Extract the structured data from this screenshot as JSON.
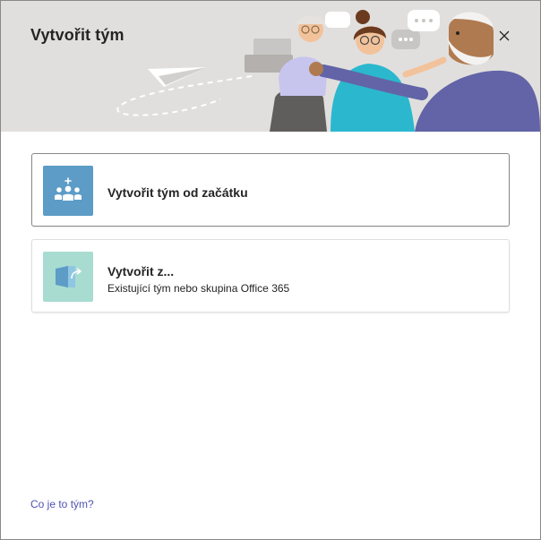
{
  "dialog": {
    "title": "Vytvořit tým",
    "close_icon": "close-icon",
    "options": [
      {
        "title": "Vytvořit tým od začátku",
        "subtitle": "",
        "icon": "team-add-icon",
        "icon_bg": "#5c9cc7",
        "selected": true
      },
      {
        "title": "Vytvořit z...",
        "subtitle": "Existující tým nebo skupina Office 365",
        "icon": "create-from-existing-icon",
        "icon_bg": "#a8dcd1",
        "selected": false
      }
    ],
    "help_link": "Co je to tým?"
  },
  "colors": {
    "header_bg": "#e1dfdd",
    "link": "#4f52b2",
    "text": "#252423",
    "accent_purple": "#6264a7"
  }
}
